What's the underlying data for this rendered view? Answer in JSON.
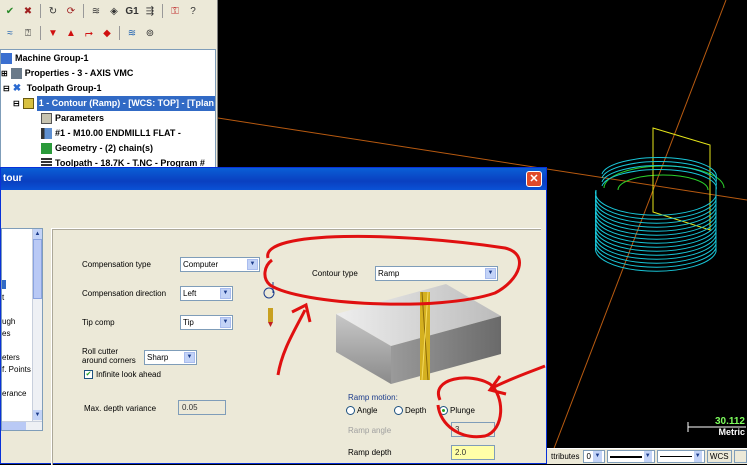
{
  "tree": {
    "items": [
      {
        "label": "Machine Group-1"
      },
      {
        "label": "Properties - 3 - AXIS VMC"
      },
      {
        "label": "Toolpath Group-1"
      },
      {
        "label": "1 - Contour (Ramp) - [WCS: TOP] - [Tplan"
      },
      {
        "label": "Parameters"
      },
      {
        "label": "#1 - M10.00 ENDMILL1 FLAT -"
      },
      {
        "label": "Geometry - (2) chain(s)"
      },
      {
        "label": "Toolpath - 18.7K - T.NC - Program #"
      }
    ]
  },
  "dialog": {
    "title": "tour",
    "close_label": "✕",
    "left_items": [
      "t",
      "ugh",
      "es",
      "eters",
      "f. Points",
      "erance"
    ],
    "compensation_type": {
      "label": "Compensation type",
      "value": "Computer"
    },
    "compensation_direction": {
      "label": "Compensation direction",
      "value": "Left"
    },
    "tip_comp": {
      "label": "Tip comp",
      "value": "Tip"
    },
    "roll_cutter": {
      "label_line1": "Roll cutter",
      "label_line2": "around corners",
      "value": "Sharp"
    },
    "infinite_look_ahead": {
      "label": "Infinite look ahead",
      "checked": true
    },
    "max_depth_variance": {
      "label": "Max. depth variance",
      "value": "0.05"
    },
    "contour_type": {
      "label": "Contour type",
      "value": "Ramp"
    },
    "ramp_motion": {
      "label": "Ramp motion:",
      "options": [
        "Angle",
        "Depth",
        "Plunge"
      ],
      "selected": "Plunge"
    },
    "ramp_angle": {
      "label": "Ramp angle",
      "value": "3"
    },
    "ramp_depth": {
      "label": "Ramp depth",
      "value": "2.0"
    }
  },
  "graphics": {
    "scale_value": "30.112",
    "scale_unit": "Metric"
  },
  "statusbar": {
    "attributes_label": "ttributes",
    "level_value": "0",
    "wcs_label": "WCS"
  },
  "colors": {
    "annotation": "#e01010",
    "toolpath": "#19c6d8",
    "axis": "#b85a10",
    "title_bar": "#0a3fc0"
  }
}
